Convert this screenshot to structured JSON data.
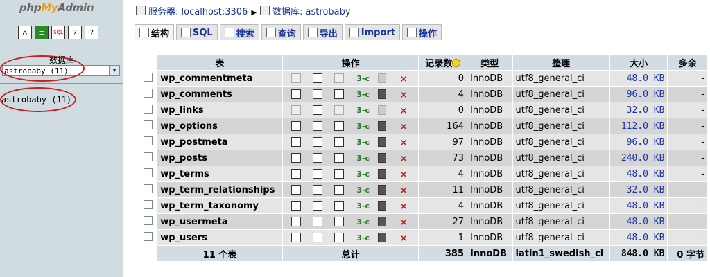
{
  "left": {
    "logo": {
      "part1": "php",
      "part2": "My",
      "part3": "Admin"
    },
    "db_label": "数据库",
    "db_select": "astrobaby (11)",
    "db_link": "astrobaby (11)"
  },
  "breadcrumb": {
    "server": "服务器: localhost:3306",
    "database": "数据库: astrobaby"
  },
  "tabs": [
    {
      "label": "结构",
      "active": true
    },
    {
      "label": "SQL",
      "active": false
    },
    {
      "label": "搜索",
      "active": false
    },
    {
      "label": "查询",
      "active": false
    },
    {
      "label": "导出",
      "active": false
    },
    {
      "label": "Import",
      "active": false
    },
    {
      "label": "操作",
      "active": false
    }
  ],
  "table": {
    "headers": {
      "table": "表",
      "action": "操作",
      "records": "记录数",
      "type": "类型",
      "collation": "整理",
      "size": "大小",
      "overhead": "多余"
    },
    "rows": [
      {
        "name": "wp_commentmeta",
        "records": "0",
        "type": "InnoDB",
        "collation": "utf8_general_ci",
        "size": "48.0 KB",
        "overhead": "-"
      },
      {
        "name": "wp_comments",
        "records": "4",
        "type": "InnoDB",
        "collation": "utf8_general_ci",
        "size": "96.0 KB",
        "overhead": "-"
      },
      {
        "name": "wp_links",
        "records": "0",
        "type": "InnoDB",
        "collation": "utf8_general_ci",
        "size": "32.0 KB",
        "overhead": "-"
      },
      {
        "name": "wp_options",
        "records": "164",
        "type": "InnoDB",
        "collation": "utf8_general_ci",
        "size": "112.0 KB",
        "overhead": "-"
      },
      {
        "name": "wp_postmeta",
        "records": "97",
        "type": "InnoDB",
        "collation": "utf8_general_ci",
        "size": "96.0 KB",
        "overhead": "-"
      },
      {
        "name": "wp_posts",
        "records": "73",
        "type": "InnoDB",
        "collation": "utf8_general_ci",
        "size": "240.0 KB",
        "overhead": "-"
      },
      {
        "name": "wp_terms",
        "records": "4",
        "type": "InnoDB",
        "collation": "utf8_general_ci",
        "size": "48.0 KB",
        "overhead": "-"
      },
      {
        "name": "wp_term_relationships",
        "records": "11",
        "type": "InnoDB",
        "collation": "utf8_general_ci",
        "size": "32.0 KB",
        "overhead": "-"
      },
      {
        "name": "wp_term_taxonomy",
        "records": "4",
        "type": "InnoDB",
        "collation": "utf8_general_ci",
        "size": "48.0 KB",
        "overhead": "-"
      },
      {
        "name": "wp_usermeta",
        "records": "27",
        "type": "InnoDB",
        "collation": "utf8_general_ci",
        "size": "48.0 KB",
        "overhead": "-"
      },
      {
        "name": "wp_users",
        "records": "1",
        "type": "InnoDB",
        "collation": "utf8_general_ci",
        "size": "48.0 KB",
        "overhead": "-"
      }
    ],
    "footer": {
      "count": "11 个表",
      "total_label": "总计",
      "records": "385",
      "type": "InnoDB",
      "collation": "latin1_swedish_ci",
      "size": "848.0 KB",
      "overhead": "0 字节"
    }
  },
  "colors": {
    "left_bg": "#d0dce0",
    "header_bg": "#d3dce3",
    "row_odd": "#e5e5e5",
    "row_even": "#d5d5d5",
    "link": "#1a3399",
    "annotation": "#c81e1e"
  }
}
